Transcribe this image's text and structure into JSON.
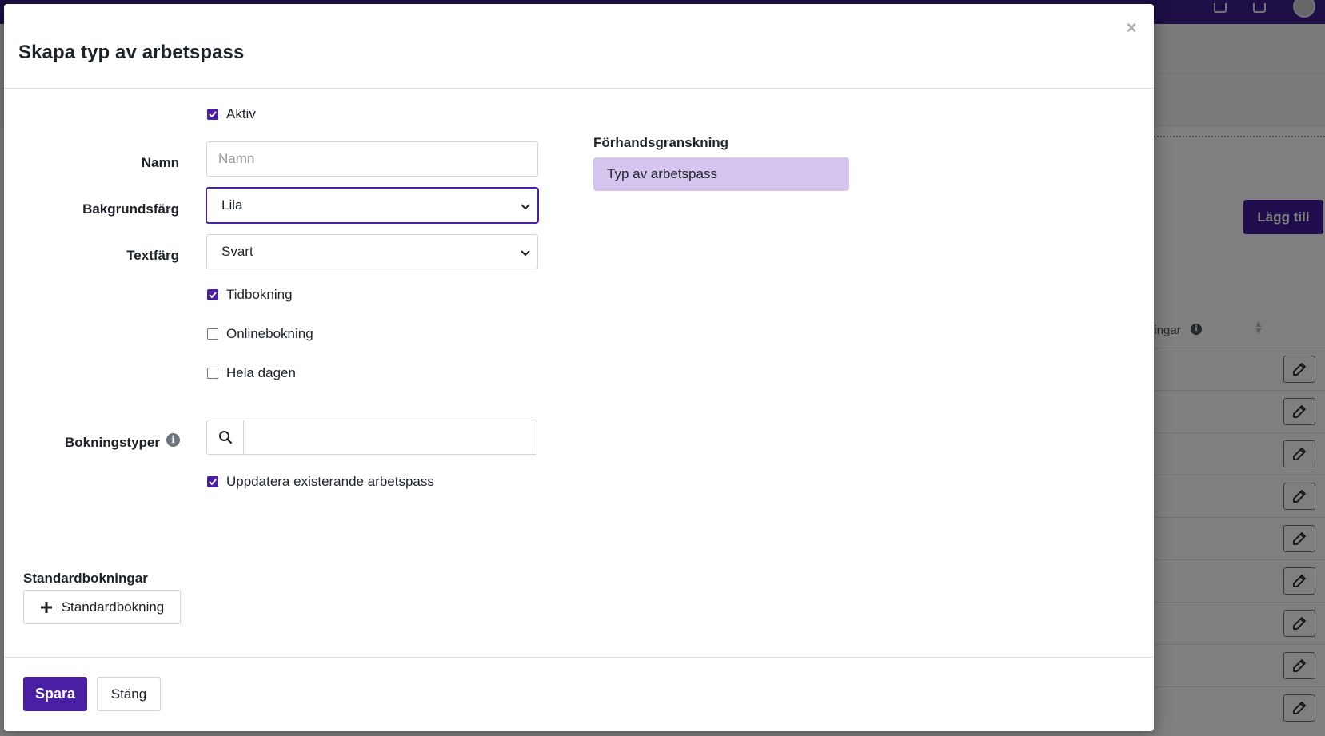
{
  "background": {
    "add_button_label": "Lägg till",
    "column_header_label": "ningar",
    "row_count": 9
  },
  "modal": {
    "title": "Skapa typ av arbetspass",
    "close_label": "×",
    "fields": {
      "active": {
        "label": "Aktiv",
        "checked": true
      },
      "name": {
        "label": "Namn",
        "placeholder": "Namn",
        "value": ""
      },
      "background_color": {
        "label": "Bakgrundsfärg",
        "value": "Lila"
      },
      "text_color": {
        "label": "Textfärg",
        "value": "Svart"
      },
      "time_booking": {
        "label": "Tidbokning",
        "checked": true
      },
      "online_booking": {
        "label": "Onlinebokning",
        "checked": false
      },
      "all_day": {
        "label": "Hela dagen",
        "checked": false
      },
      "booking_types": {
        "label": "Bokningstyper",
        "value": ""
      },
      "update_existing": {
        "label": "Uppdatera existerande arbetspass",
        "checked": true
      }
    },
    "preview": {
      "title": "Förhandsgranskning",
      "chip_text": "Typ av arbetspass",
      "chip_color": "#d4c5ee",
      "text_color": "#1e2329"
    },
    "default_bookings": {
      "title": "Standardbokningar",
      "add_label": "Standardbokning"
    },
    "footer": {
      "save_label": "Spara",
      "close_label": "Stäng"
    },
    "colors": {
      "accent": "#4b1fa3",
      "topbar": "#3b1d8a"
    }
  }
}
